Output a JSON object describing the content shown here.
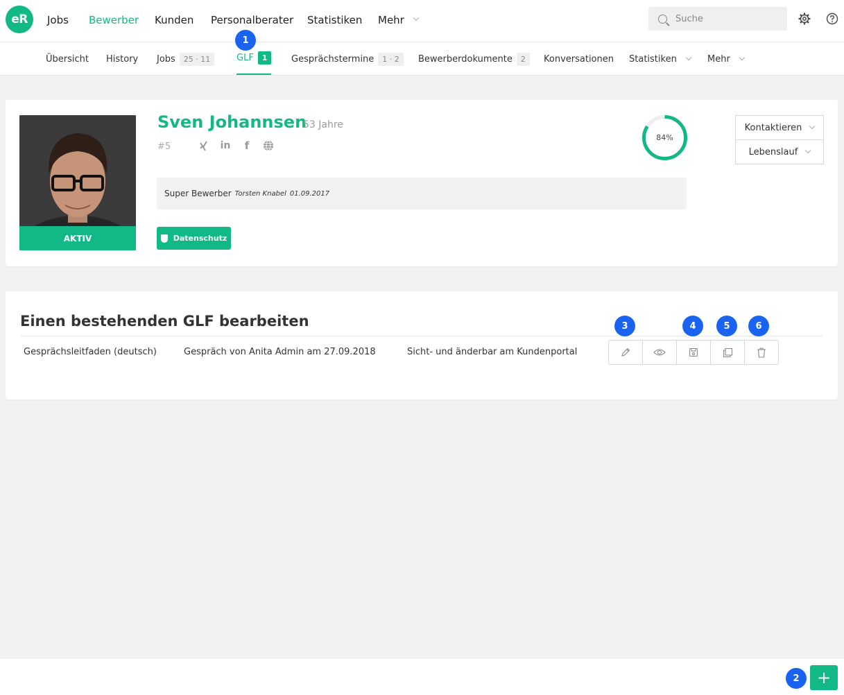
{
  "logo": {
    "text": "eR"
  },
  "topnav": {
    "items": [
      {
        "label": "Jobs"
      },
      {
        "label": "Bewerber"
      },
      {
        "label": "Kunden"
      },
      {
        "label": "Personalberater"
      },
      {
        "label": "Statistiken"
      },
      {
        "label": "Mehr"
      }
    ],
    "active": "Bewerber"
  },
  "search": {
    "placeholder": "Suche"
  },
  "subnav": {
    "items": [
      {
        "label": "Übersicht"
      },
      {
        "label": "History"
      },
      {
        "label": "Jobs",
        "badge": "25 · 11"
      },
      {
        "label": "GLF",
        "badge": "1"
      },
      {
        "label": "Gesprächstermine",
        "badge": "1 · 2"
      },
      {
        "label": "Bewerberdokumente",
        "badge": "2"
      },
      {
        "label": "Konversationen"
      },
      {
        "label": "Statistiken"
      },
      {
        "label": "Mehr"
      }
    ],
    "active": "GLF"
  },
  "callouts": {
    "c1": "1",
    "c2": "2",
    "c3": "3",
    "c4": "4",
    "c5": "5",
    "c6": "6"
  },
  "candidate": {
    "name": "Sven Johannsen",
    "age": "53 Jahre",
    "id": "#5",
    "status": "AKTIV",
    "progress_percent": 84,
    "progress_label": "84%",
    "comment": {
      "text": "Super Bewerber",
      "author": "Torsten Knabel",
      "date": "01.09.2017"
    },
    "privacy_button": "Datenschutz",
    "actions": {
      "contact": "Kontaktieren",
      "cv": "Lebenslauf"
    },
    "social_icons": [
      "xing-icon",
      "linkedin-icon",
      "facebook-icon",
      "globe-icon"
    ]
  },
  "glf": {
    "title": "Einen bestehenden GLF bearbeiten",
    "rows": [
      {
        "name": "Gesprächsleitfaden (deutsch)",
        "conversation": "Gespräch von Anita Admin am 27.09.2018",
        "visibility": "Sicht- und änderbar am Kundenportal"
      }
    ],
    "row_icons": [
      "pencil-icon",
      "eye-icon",
      "save-icon",
      "copy-icon",
      "trash-icon"
    ]
  },
  "bottom": {
    "add_label": "+"
  },
  "colors": {
    "brand": "#12b886",
    "callout": "#1a63f0"
  }
}
